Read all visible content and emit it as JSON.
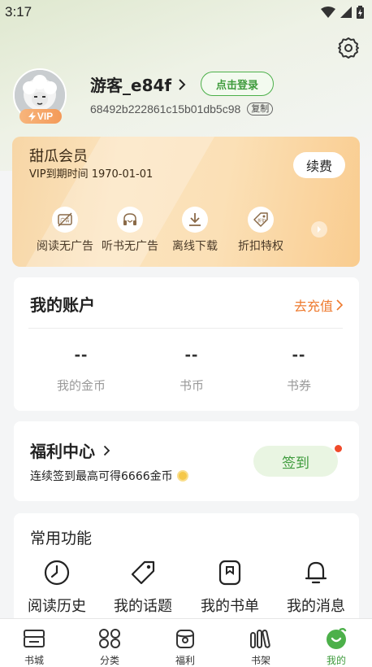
{
  "status_bar": {
    "time": "3:17"
  },
  "profile": {
    "username": "游客_e84f",
    "login_label": "点击登录",
    "user_id": "68492b222861c15b01db5c98",
    "copy_label": "复制",
    "vip_badge": "VIP"
  },
  "vip_card": {
    "title": "甜瓜会员",
    "expire": "VIP到期时间 1970-01-01",
    "renew_label": "续费",
    "perks": [
      {
        "label": "阅读无广告",
        "icon": "no-ads-icon"
      },
      {
        "label": "听书无广告",
        "icon": "audiobook-icon"
      },
      {
        "label": "离线下载",
        "icon": "download-icon"
      },
      {
        "label": "折扣特权",
        "icon": "discount-tag-icon"
      }
    ]
  },
  "account": {
    "title": "我的账户",
    "recharge_label": "去充值",
    "items": [
      {
        "value": "--",
        "label": "我的金币"
      },
      {
        "value": "--",
        "label": "书币"
      },
      {
        "value": "--",
        "label": "书券"
      }
    ]
  },
  "welfare": {
    "title": "福利中心",
    "subtitle": "连续签到最高可得6666金币",
    "checkin_label": "签到"
  },
  "common": {
    "title": "常用功能",
    "items": [
      {
        "label": "阅读历史",
        "icon": "history-icon"
      },
      {
        "label": "我的话题",
        "icon": "tag-icon"
      },
      {
        "label": "我的书单",
        "icon": "booklist-icon"
      },
      {
        "label": "我的消息",
        "icon": "bell-icon"
      }
    ]
  },
  "tabs": [
    {
      "label": "书城",
      "icon": "bookstore-icon"
    },
    {
      "label": "分类",
      "icon": "category-icon"
    },
    {
      "label": "福利",
      "icon": "welfare-icon"
    },
    {
      "label": "书架",
      "icon": "bookshelf-icon"
    },
    {
      "label": "我的",
      "icon": "profile-icon",
      "active": true
    }
  ],
  "colors": {
    "accent_green": "#3e9b3c",
    "accent_orange": "#ee7a2e",
    "vip_gold": "#f9cc8f"
  }
}
